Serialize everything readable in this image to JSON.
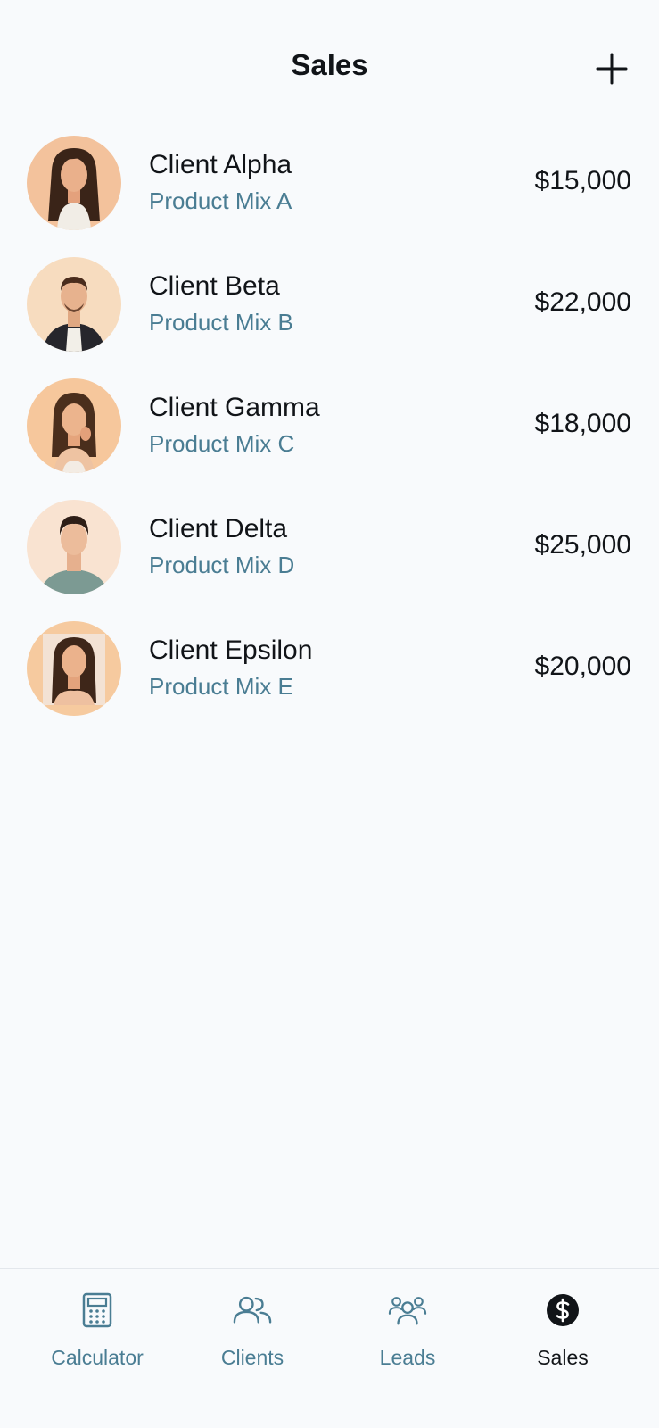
{
  "header": {
    "title": "Sales",
    "add_icon": "plus-icon"
  },
  "sales": [
    {
      "client": "Client Alpha",
      "product": "Product Mix A",
      "amount": "$15,000"
    },
    {
      "client": "Client Beta",
      "product": "Product Mix B",
      "amount": "$22,000"
    },
    {
      "client": "Client Gamma",
      "product": "Product Mix C",
      "amount": "$18,000"
    },
    {
      "client": "Client Delta",
      "product": "Product Mix D",
      "amount": "$25,000"
    },
    {
      "client": "Client Epsilon",
      "product": "Product Mix E",
      "amount": "$20,000"
    }
  ],
  "nav": {
    "items": [
      {
        "label": "Calculator",
        "icon": "calculator-icon",
        "active": false
      },
      {
        "label": "Clients",
        "icon": "clients-icon",
        "active": false
      },
      {
        "label": "Leads",
        "icon": "leads-icon",
        "active": false
      },
      {
        "label": "Sales",
        "icon": "dollar-icon",
        "active": true
      }
    ]
  },
  "colors": {
    "background": "#f8fafc",
    "text_primary": "#111418",
    "accent_muted": "#4a7d93",
    "avatar_peach": "#f6c9a3"
  }
}
